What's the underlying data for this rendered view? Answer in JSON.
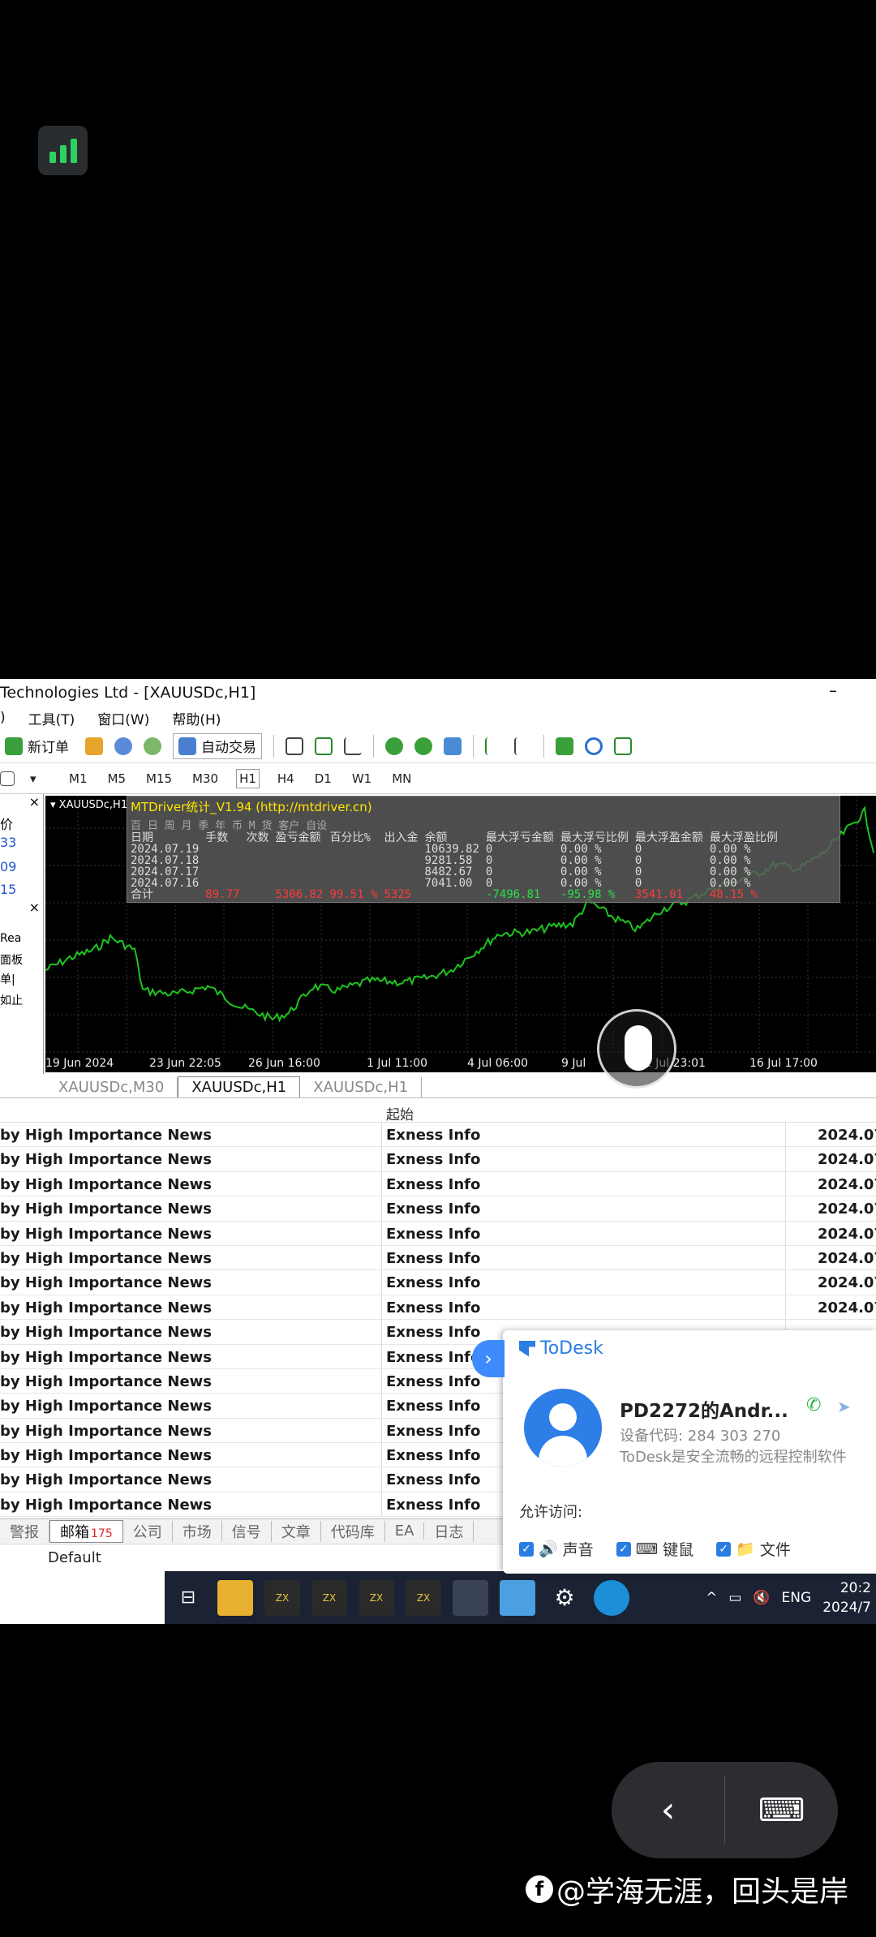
{
  "window": {
    "title": "Technologies Ltd - [XAUUSDc,H1]",
    "minimize": "–"
  },
  "menu": [
    "工具(T)",
    "窗口(W)",
    "帮助(H)"
  ],
  "menu_prefix": ")",
  "toolbar": {
    "new_order": "新订单",
    "auto_trade": "自动交易"
  },
  "timeframes": [
    "M1",
    "M5",
    "M15",
    "M30",
    "H1",
    "H4",
    "D1",
    "W1",
    "MN"
  ],
  "left_panel": [
    "价",
    "33",
    "09",
    "15",
    "",
    "Rea",
    "面板",
    "单|",
    "如止"
  ],
  "chart": {
    "symbol": "XAUUSDc,H1",
    "overlay_title": "MTDriver统计_V1.94 (http://mtdriver.cn)",
    "overlay_menu": "百 日 周 月 季 年 币 M 货 客户 自设",
    "headers": [
      "日期",
      "手数",
      "次数",
      "盈亏金额",
      "百分比%",
      "出入金",
      "余额",
      "最大浮亏金额",
      "最大浮亏比例",
      "最大浮盈金额",
      "最大浮盈比例"
    ],
    "rows": [
      [
        "2024.07.19",
        "",
        "",
        "",
        "",
        "",
        "10639.82",
        "0",
        "0.00 %",
        "0",
        "0.00 %"
      ],
      [
        "2024.07.18",
        "",
        "",
        "",
        "",
        "",
        "9281.58",
        "0",
        "0.00 %",
        "0",
        "0.00 %"
      ],
      [
        "2024.07.17",
        "",
        "",
        "",
        "",
        "",
        "8482.67",
        "0",
        "0.00 %",
        "0",
        "0.00 %"
      ],
      [
        "2024.07.16",
        "",
        "",
        "",
        "",
        "",
        "7041.00",
        "0",
        "0.00 %",
        "0",
        "0.00 %"
      ]
    ],
    "total": [
      "合计",
      "89.77",
      "",
      "5306.82",
      "99.51 %",
      "5325",
      "",
      "-7496.81",
      "-95.98 %",
      "3541.01",
      "48.15 %"
    ],
    "xaxis": [
      "19 Jun 2024",
      "23 Jun 22:05",
      "26 Jun 16:00",
      "1 Jul 11:00",
      "4 Jul 06:00",
      "9 Jul",
      "11 Jul 23:01",
      "16 Jul 17:00"
    ]
  },
  "chart_tabs": [
    "XAUUSDc,M30",
    "XAUUSDc,H1",
    "XAUUSDc,H1"
  ],
  "table": {
    "header_col2": "起始",
    "rows": [
      [
        "by High Importance News",
        "Exness Info",
        "2024.07"
      ],
      [
        "by High Importance News",
        "Exness Info",
        "2024.07"
      ],
      [
        "by High Importance News",
        "Exness Info",
        "2024.07"
      ],
      [
        "by High Importance News",
        "Exness Info",
        "2024.07"
      ],
      [
        "by High Importance News",
        "Exness Info",
        "2024.07"
      ],
      [
        "by High Importance News",
        "Exness Info",
        "2024.07"
      ],
      [
        "by High Importance News",
        "Exness Info",
        "2024.07"
      ],
      [
        "by High Importance News",
        "Exness Info",
        "2024.07"
      ],
      [
        "by High Importance News",
        "Exness Info",
        ""
      ],
      [
        "by High Importance News",
        "Exness Info",
        ""
      ],
      [
        "by High Importance News",
        "Exness Info",
        ""
      ],
      [
        "by High Importance News",
        "Exness Info",
        ""
      ],
      [
        "by High Importance News",
        "Exness Info",
        ""
      ],
      [
        "by High Importance News",
        "Exness Info",
        ""
      ],
      [
        "by High Importance News",
        "Exness Info",
        ""
      ],
      [
        "by High Importance News",
        "Exness Info",
        ""
      ]
    ]
  },
  "bottom_tabs": {
    "items": [
      "警报",
      "邮箱",
      "公司",
      "市场",
      "信号",
      "文章",
      "代码库",
      "EA",
      "日志"
    ],
    "mail_badge": "175"
  },
  "status": {
    "profile": "Default"
  },
  "taskbar": {
    "lang": "ENG",
    "time": "20:2",
    "date": "2024/7"
  },
  "todesk": {
    "brand": "ToDesk",
    "device_name": "PD2272的Andr...",
    "device_code": "设备代码: 284 303 270",
    "desc": "ToDesk是安全流畅的远程控制软件",
    "allow_label": "允许访问:",
    "options": [
      "声音",
      "键鼠",
      "文件"
    ]
  },
  "watermark": "@学海无涯，回头是岸",
  "colors": {
    "chart_line": "#1fc41f",
    "overlay_title": "#ffe600",
    "todesk_blue": "#2a7de1",
    "signal_green": "#2fd062"
  }
}
